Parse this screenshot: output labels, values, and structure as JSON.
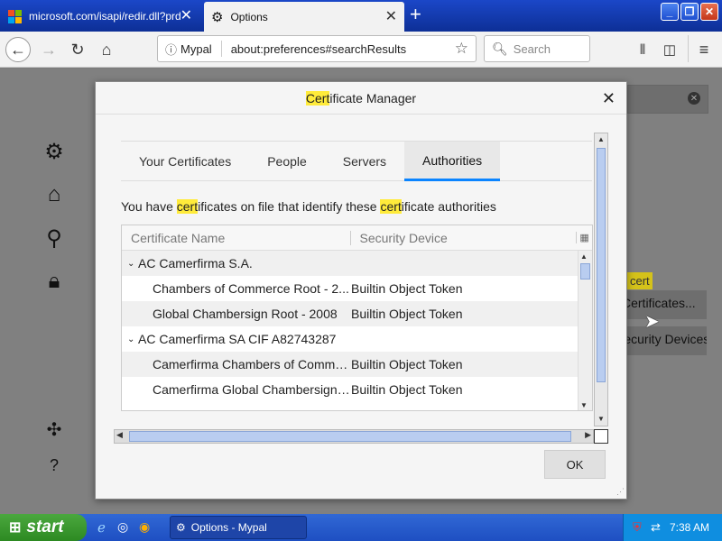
{
  "tabs": [
    {
      "title": "microsoft.com/isapi/redir.dll?prd=..."
    },
    {
      "title": "Options"
    }
  ],
  "nav": {
    "identity": "Mypal",
    "url": "about:preferences#searchResults",
    "search_placeholder": "Search"
  },
  "background": {
    "highlight_text": "cert",
    "certificates_button": "Certificates...",
    "security_devices_button": "Security Devices..."
  },
  "dialog": {
    "title_prefix": "",
    "title_highlight": "Cert",
    "title_suffix": "ificate Manager",
    "tabs": [
      "Your Certificates",
      "People",
      "Servers",
      "Authorities"
    ],
    "active_tab": "Authorities",
    "desc_1": "You have ",
    "desc_hl1": "cert",
    "desc_2": "ificates on file that identify these ",
    "desc_hl2": "cert",
    "desc_3": "ificate authorities",
    "columns": [
      "Certificate Name",
      "Security Device"
    ],
    "rows": [
      {
        "name": "AC Camerfirma S.A.",
        "device": "",
        "type": "group"
      },
      {
        "name": "Chambers of Commerce Root - 2...",
        "device": "Builtin Object Token",
        "type": "leaf"
      },
      {
        "name": "Global Chambersign Root - 2008",
        "device": "Builtin Object Token",
        "type": "leaf"
      },
      {
        "name": "AC Camerfirma SA CIF A82743287",
        "device": "",
        "type": "group"
      },
      {
        "name": "Camerfirma Chambers of Comme...",
        "device": "Builtin Object Token",
        "type": "leaf"
      },
      {
        "name": "Camerfirma Global Chambersign R...",
        "device": "Builtin Object Token",
        "type": "leaf"
      }
    ],
    "ok_label": "OK"
  },
  "taskbar": {
    "start_label": "start",
    "task_label": "Options - Mypal",
    "clock": "7:38 AM"
  },
  "colors": {
    "highlight": "#ffeb3b",
    "accent": "#0a84ff",
    "taskbar": "#245edb",
    "start": "#3c9a30"
  }
}
